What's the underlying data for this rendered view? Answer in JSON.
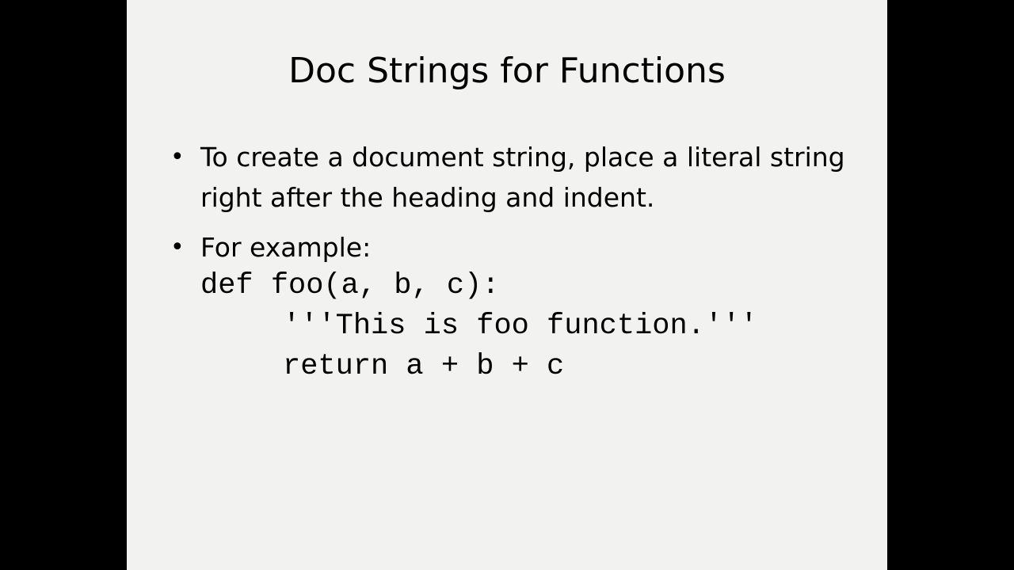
{
  "slide": {
    "title": "Doc Strings for Functions",
    "bullets": [
      "To create a document string, place a literal string right after the heading and indent.",
      "For example:"
    ],
    "bullet_glyph": "•",
    "code": [
      "def foo(a, b, c):",
      "'''This is foo function.'''",
      "return a + b + c"
    ]
  },
  "colors": {
    "background": "#000000",
    "slide": "#f2f3f0",
    "text": "#000000"
  }
}
